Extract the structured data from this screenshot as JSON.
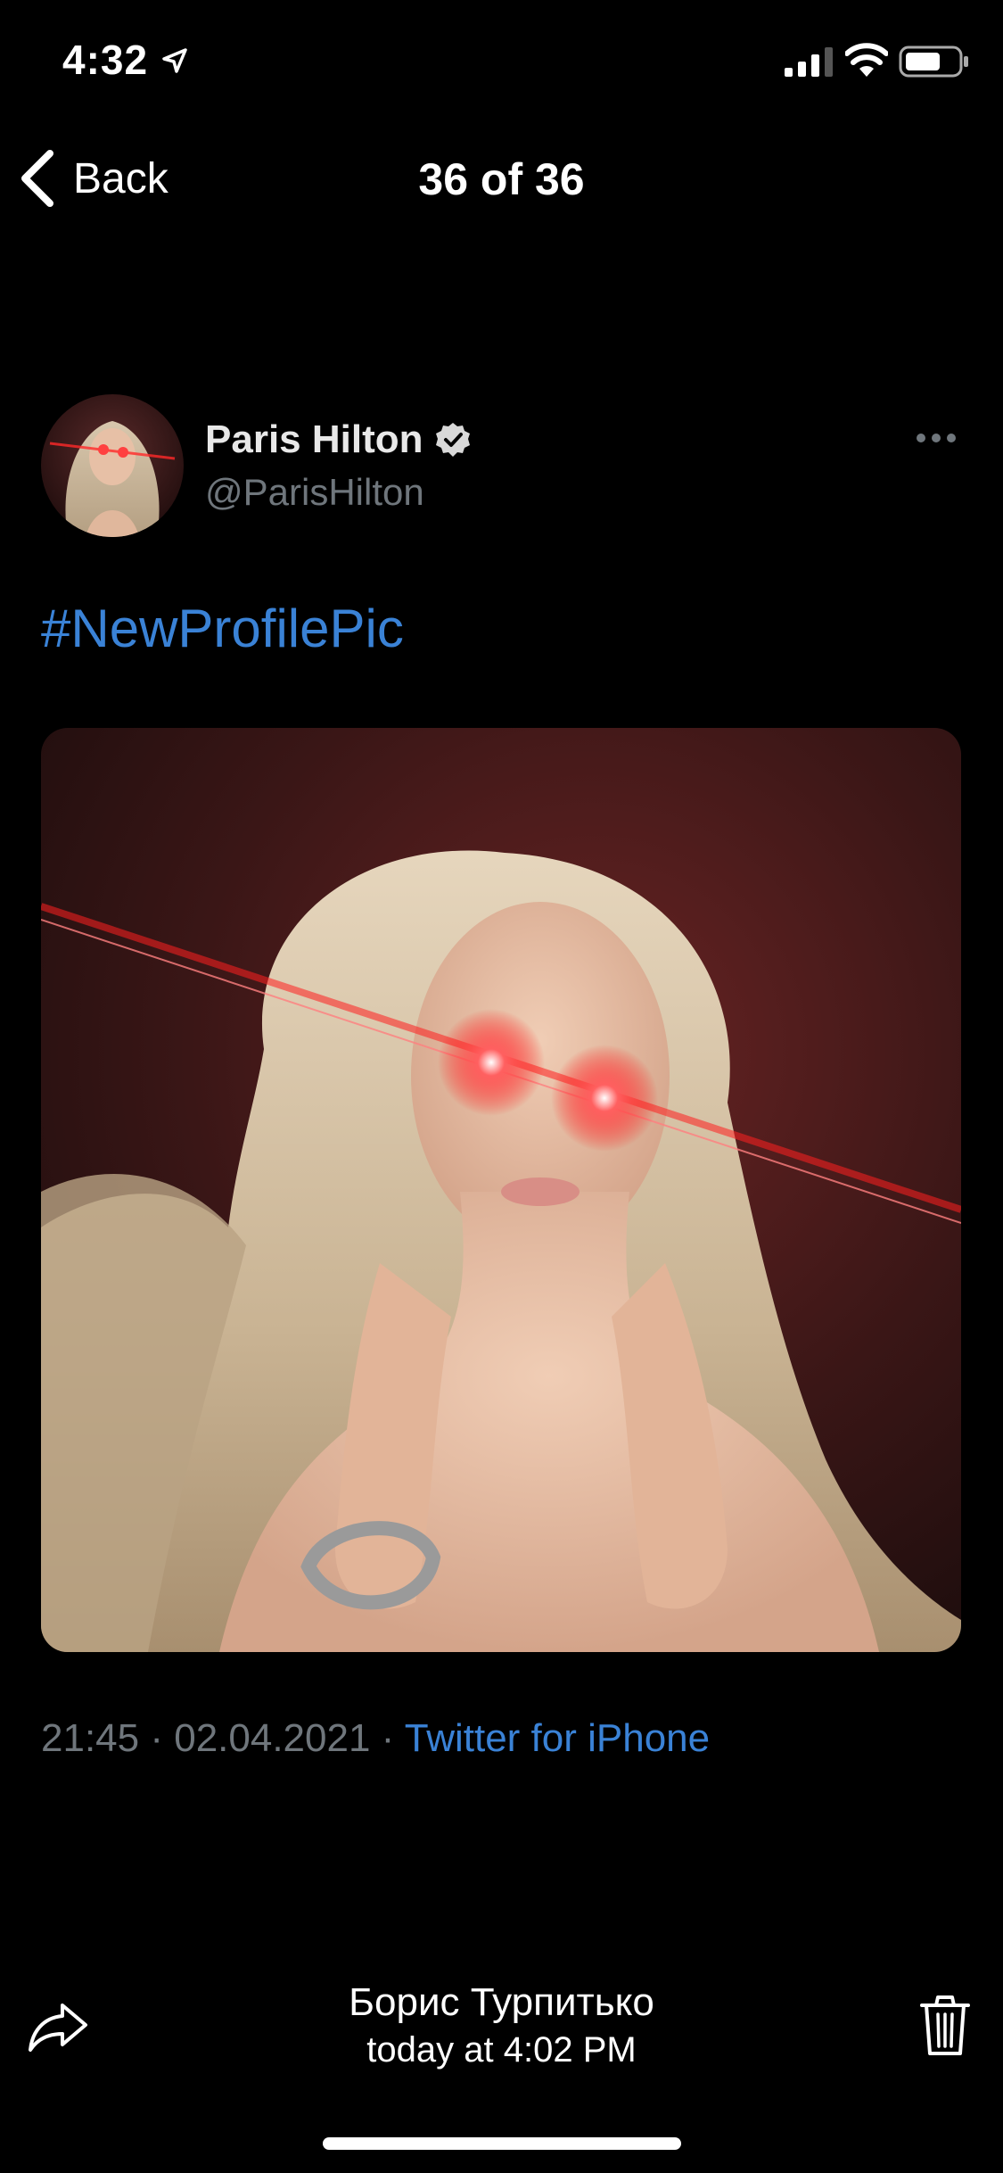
{
  "status_bar": {
    "time": "4:32",
    "icons": [
      "location-arrow-icon",
      "cellular-signal-icon",
      "wifi-icon",
      "battery-icon"
    ]
  },
  "nav": {
    "back_label": "Back",
    "title": "36 of 36"
  },
  "tweet": {
    "author_name": "Paris Hilton",
    "author_handle": "@ParisHilton",
    "verified": true,
    "text": "#NewProfilePic",
    "meta_time": "21:45",
    "meta_separator": " · ",
    "meta_date": "02.04.2021",
    "meta_source": "Twitter for iPhone"
  },
  "footer": {
    "sender_name": "Борис Турпитько",
    "sent_time": "today at 4:02 PM"
  },
  "colors": {
    "background": "#000000",
    "link_blue": "#3a82d6",
    "muted_gray": "#6f767c"
  }
}
